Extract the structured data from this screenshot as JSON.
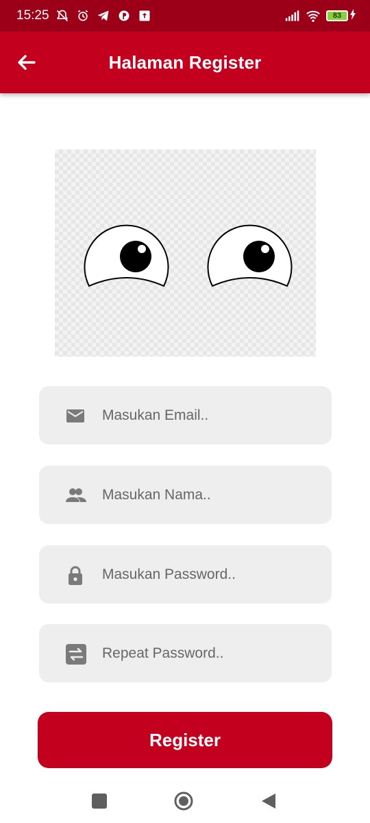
{
  "status_bar": {
    "time": "15:25",
    "battery": "83"
  },
  "app_bar": {
    "title": "Halaman Register"
  },
  "form": {
    "email_placeholder": "Masukan Email..",
    "name_placeholder": "Masukan Nama..",
    "password_placeholder": "Masukan Password..",
    "repeat_password_placeholder": "Repeat Password..",
    "register_label": "Register"
  },
  "icons": {
    "back": "arrow-back-icon",
    "email": "mail-icon",
    "name": "people-icon",
    "password": "lock-icon",
    "repeat_password": "swap-icon",
    "nav_recents": "square-icon",
    "nav_home": "circle-icon",
    "nav_back": "triangle-back-icon"
  },
  "colors": {
    "status_bar": "#9b0018",
    "primary": "#c4001f",
    "field_bg": "#eeeeee",
    "placeholder_text": "#666666"
  }
}
